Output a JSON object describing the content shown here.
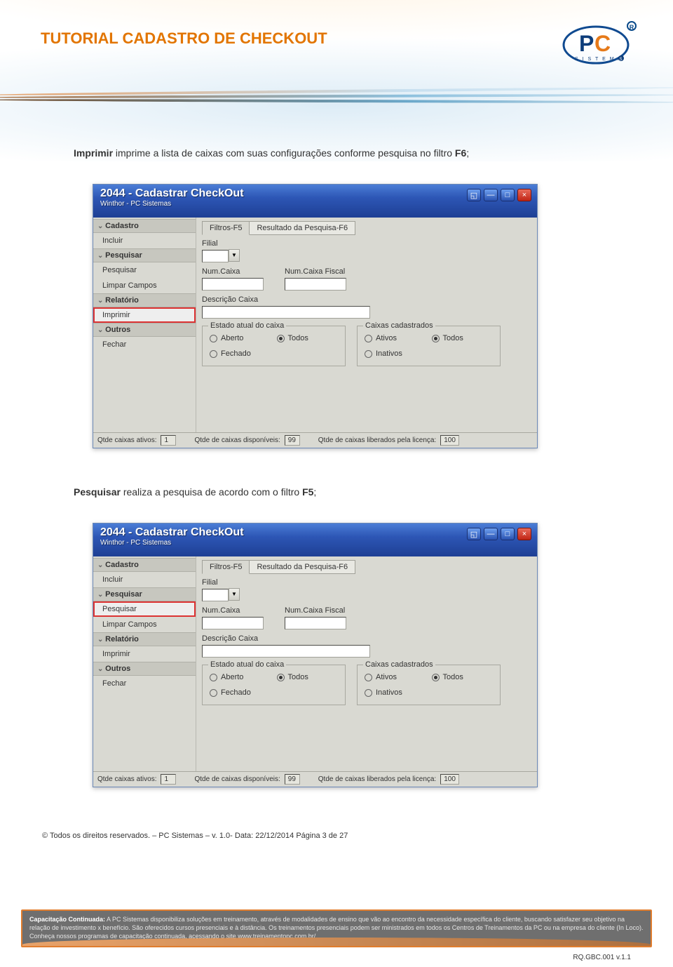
{
  "doc": {
    "title": "TUTORIAL CADASTRO DE CHECKOUT",
    "para1_prefix_bold": "Imprimir",
    "para1_rest": " imprime a lista de caixas com suas configurações conforme pesquisa no filtro ",
    "para1_filter": "F6",
    "para2_prefix_bold": "Pesquisar",
    "para2_rest": " realiza a pesquisa de acordo com o filtro ",
    "para2_filter": "F5",
    "copyright": "© Todos os direitos reservados. – PC Sistemas – v. 1.0- Data: 22/12/2014  Página 3 de 27",
    "footer_label": "Capacitação Continuada:",
    "footer_text": " A PC Sistemas disponibiliza soluções em treinamento, através de modalidades de ensino que vão ao encontro da necessidade específica do cliente, buscando satisfazer seu objetivo na relação de investimento x benefício. São oferecidos cursos presenciais e à distância. Os treinamentos presenciais podem ser ministrados em todos os Centros de Treinamentos da PC ou na empresa do cliente (In Loco). Conheça nossos programas de capacitação continuada, acessando o site www.treinamentopc.com.br/",
    "doc_code": "RQ.GBC.001 v.1.1",
    "logo_sub": "S I S T E M A S"
  },
  "win": {
    "title": "2044 - Cadastrar CheckOut",
    "subtitle": "Winthor - PC Sistemas",
    "sidebar": {
      "groups": [
        {
          "header": "Cadastro",
          "items": [
            "Incluir"
          ]
        },
        {
          "header": "Pesquisar",
          "items": [
            "Pesquisar",
            "Limpar Campos"
          ]
        },
        {
          "header": "Relatório",
          "items": [
            "Imprimir"
          ]
        },
        {
          "header": "Outros",
          "items": [
            "Fechar"
          ]
        }
      ]
    },
    "tabs": [
      "Filtros-F5",
      "Resultado da Pesquisa-F6"
    ],
    "labels": {
      "filial": "Filial",
      "numcaixa": "Num.Caixa",
      "numcaixaf": "Num.Caixa Fiscal",
      "descricao": "Descrição Caixa",
      "grp1": "Estado atual do caixa",
      "grp2": "Caixas cadastrados",
      "aberto": "Aberto",
      "fechado": "Fechado",
      "todos": "Todos",
      "ativos": "Ativos",
      "inativos": "Inativos"
    },
    "status": {
      "l1": "Qtde caixas ativos:",
      "v1": "1",
      "l2": "Qtde de caixas disponíveis:",
      "v2": "99",
      "l3": "Qtde de caixas liberados pela licença:",
      "v3": "100"
    }
  }
}
